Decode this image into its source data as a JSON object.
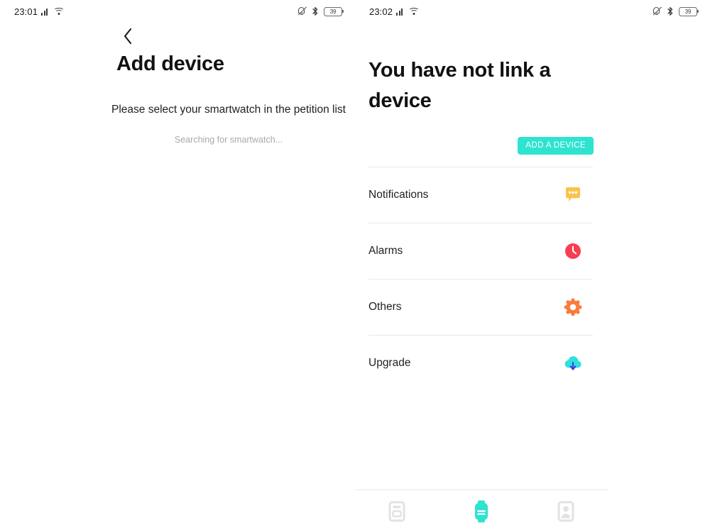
{
  "colors": {
    "accent_teal": "#2ee3cf",
    "notifications_icon": "#fcc councils",
    "notification_bubble": "#fbc34a",
    "alarm_red": "#f83f52",
    "gear_orange": "#f97b3d",
    "cloud_cyan": "#2fe0e0",
    "cloud_arrow_blue": "#3a49d8",
    "nav_inactive": "#e2e2e2",
    "divider": "#e8e8e8",
    "text_primary": "#1f1f1f",
    "text_muted": "#a9a9a9"
  },
  "left_screen": {
    "status_bar": {
      "time": "23:01",
      "icons_left": [
        "signal-icon",
        "wifi-icon"
      ],
      "icons_right": [
        "bell-mute-icon",
        "bluetooth-icon",
        "battery-icon"
      ],
      "battery_level": "39"
    },
    "back_icon": "chevron-left-icon",
    "title": "Add device",
    "subtitle": "Please select your smartwatch in the petition list",
    "status_text": "Searching for smartwatch..."
  },
  "right_screen": {
    "status_bar": {
      "time": "23:02",
      "icons_left": [
        "signal-icon",
        "wifi-icon"
      ],
      "icons_right": [
        "bell-mute-icon",
        "bluetooth-icon",
        "battery-icon"
      ],
      "battery_level": "39"
    },
    "hero_title": "You have not link a device",
    "add_device_button": "ADD A DEVICE",
    "menu_items": [
      {
        "label": "Notifications",
        "icon": "chat-bubble-icon"
      },
      {
        "label": "Alarms",
        "icon": "alarm-clock-icon"
      },
      {
        "label": "Others",
        "icon": "gear-icon"
      },
      {
        "label": "Upgrade",
        "icon": "cloud-download-icon"
      }
    ],
    "bottom_nav": [
      {
        "icon": "cards-list-icon",
        "active": false
      },
      {
        "icon": "smartwatch-icon",
        "active": true
      },
      {
        "icon": "profile-icon",
        "active": false
      }
    ]
  }
}
